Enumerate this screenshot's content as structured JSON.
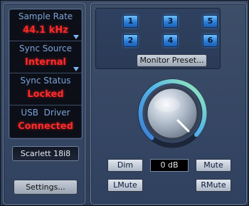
{
  "status": {
    "sample_rate": {
      "label": "Sample Rate",
      "value": "44.1 kHz"
    },
    "sync_source": {
      "label": "Sync Source",
      "value": "Internal"
    },
    "sync_status": {
      "label": "Sync Status",
      "value": "Locked"
    },
    "usb_driver": {
      "label": "USB  Driver",
      "value": "Connected"
    }
  },
  "device": {
    "name": "Scarlett 18i8"
  },
  "buttons": {
    "settings": "Settings...",
    "monitor_preset": "Monitor Preset...",
    "dim": "Dim",
    "mute": "Mute",
    "lmute": "LMute",
    "rmute": "RMute"
  },
  "presets": [
    "1",
    "2",
    "3",
    "4",
    "5",
    "6"
  ],
  "monitor": {
    "level": "0 dB"
  },
  "colors": {
    "status_value": "#ff2a2a",
    "status_label": "#7da4d8",
    "preset_button": "#2c7fd8",
    "knob_arc_start": "#3a7fd6",
    "knob_arc_end": "#9ff0b0"
  },
  "icons": {
    "dropdown": "chevron-down-icon",
    "knob": "volume-knob-icon"
  }
}
